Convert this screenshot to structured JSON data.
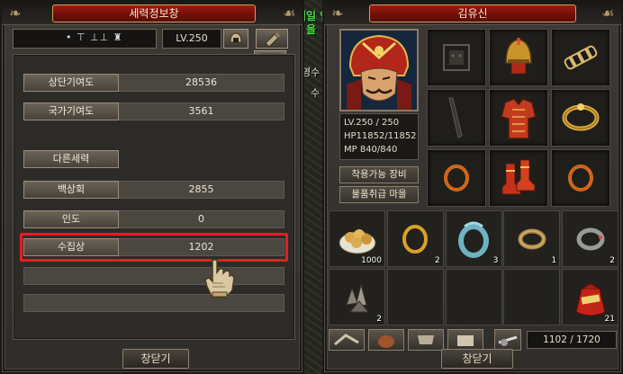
{
  "overlay": {
    "quest_label": "매일 임무",
    "quest_label_2": "을",
    "map_fragment_1": "영수",
    "map_fragment_2": "수"
  },
  "power_window": {
    "title": "세력정보창",
    "level": "LV.250",
    "name_marks": "• ⊤ ⊥⊥ ♜",
    "stats": [
      {
        "label": "상단기여도",
        "value": "28536"
      },
      {
        "label": "국가기여도",
        "value": "3561"
      },
      {
        "label": "다른세력",
        "value": ""
      },
      {
        "label": "백상회",
        "value": "2855"
      },
      {
        "label": "인도",
        "value": "0"
      },
      {
        "label": "수집상",
        "value": "1202"
      }
    ],
    "close_label": "창닫기"
  },
  "char_window": {
    "title": "김유신",
    "level_line": "LV.250 / 250",
    "hp_line": "HP11852/11852",
    "mp_line": "MP  840/840",
    "btn_equip": "착용가능 장비",
    "btn_items": "물품취급 마을",
    "inventory_qty": [
      "1000",
      "2",
      "3",
      "1",
      "2",
      "2",
      "",
      "",
      "",
      "21"
    ],
    "weight": "1102 / 1720",
    "close_label": "창닫기"
  },
  "colors": {
    "title_red": "#8a1510",
    "highlight": "#e81d24",
    "quest_green": "#49e04a"
  }
}
